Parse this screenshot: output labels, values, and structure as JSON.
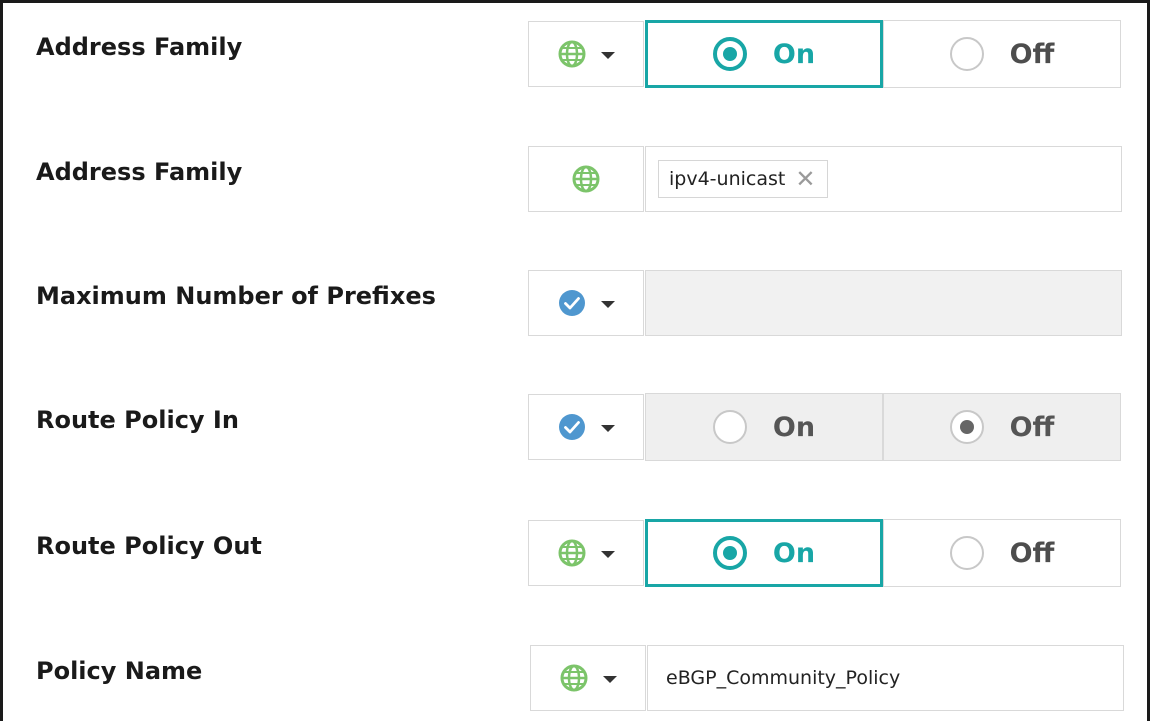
{
  "rows": [
    {
      "label": "Address Family",
      "scope_icon": "globe-icon",
      "control": "toggle",
      "on_label": "On",
      "off_label": "Off",
      "selected": "on"
    },
    {
      "label": "Address Family",
      "scope_icon": "globe-icon",
      "control": "tags",
      "tags": [
        "ipv4-unicast"
      ],
      "remove_glyph": "✕"
    },
    {
      "label": "Maximum Number of Prefixes",
      "scope_icon": "check-circle-icon",
      "control": "text",
      "value": ""
    },
    {
      "label": "Route Policy In",
      "scope_icon": "check-circle-icon",
      "control": "toggle-disabled",
      "on_label": "On",
      "off_label": "Off",
      "selected": "off"
    },
    {
      "label": "Route Policy Out",
      "scope_icon": "globe-icon",
      "control": "toggle",
      "on_label": "On",
      "off_label": "Off",
      "selected": "on"
    },
    {
      "label": "Policy Name",
      "scope_icon": "globe-icon",
      "control": "text",
      "value": "eBGP_Community_Policy"
    }
  ],
  "colors": {
    "accent": "#18a6a6",
    "globe": "#7cc46a",
    "check": "#4f97cf",
    "border": "#d9d9d9",
    "disabled_bg": "#efefef"
  }
}
